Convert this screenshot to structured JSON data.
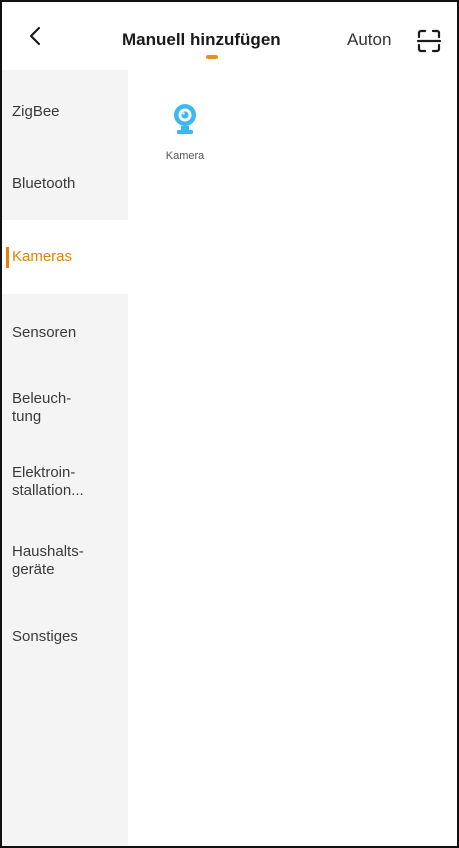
{
  "header": {
    "tabs": [
      {
        "label": "Manuell hinzufügen",
        "active": true
      },
      {
        "label": "Automatisch scannen",
        "visible_text": "Auton",
        "active": false
      }
    ],
    "accent_color": "#f08c1a"
  },
  "sidebar": {
    "items": [
      {
        "label": "ZigBee",
        "active": false
      },
      {
        "label": "Bluetooth",
        "active": false
      },
      {
        "label": "Kameras",
        "active": true
      },
      {
        "label": "Sensoren",
        "active": false
      },
      {
        "label": "Beleuch-\ntung",
        "active": false
      },
      {
        "label": "Elektroin-\nstallation...",
        "active": false
      },
      {
        "label": "Haushalts-\ngeräte",
        "active": false
      },
      {
        "label": "Sonstiges",
        "active": false
      }
    ]
  },
  "content": {
    "devices": [
      {
        "label": "Kamera",
        "icon": "camera-icon"
      }
    ]
  },
  "colors": {
    "active_text": "#e0820a",
    "sidebar_bg": "#f4f4f4",
    "camera_blue": "#3bb8f0"
  }
}
